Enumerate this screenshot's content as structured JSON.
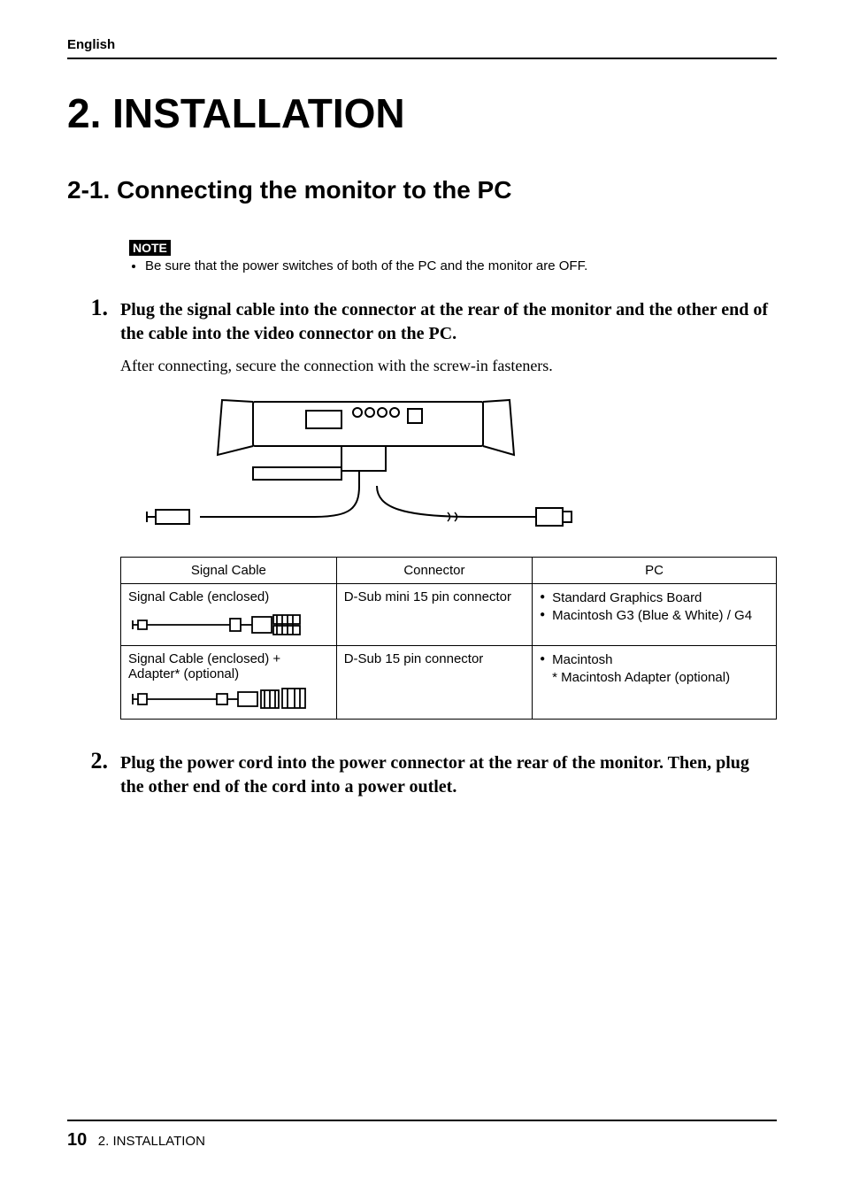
{
  "header": {
    "language": "English"
  },
  "chapter": {
    "title": "2. INSTALLATION"
  },
  "section": {
    "title": "2-1. Connecting the monitor to the PC"
  },
  "note": {
    "badge": "NOTE",
    "items": [
      "Be sure that the power switches of both of the PC and the monitor are OFF."
    ]
  },
  "steps": [
    {
      "number": "1.",
      "heading": "Plug the signal cable into the connector at the rear of the monitor and the other end of the cable into the video connector on the PC.",
      "subtext": "After connecting, secure the connection with the screw-in fasteners."
    },
    {
      "number": "2.",
      "heading": "Plug the power cord into the power connector at the rear of the monitor.  Then, plug the other end of the cord into a power outlet."
    }
  ],
  "table": {
    "headers": [
      "Signal Cable",
      "Connector",
      "PC"
    ],
    "rows": [
      {
        "signal": "Signal Cable (enclosed)",
        "connector": "D-Sub mini 15 pin connector",
        "pc": [
          "Standard Graphics Board",
          "Macintosh G3 (Blue & White) / G4"
        ]
      },
      {
        "signal_line1": "Signal Cable (enclosed) +",
        "signal_line2": "Adapter* (optional)",
        "connector": "D-Sub 15 pin connector",
        "pc": [
          "Macintosh"
        ],
        "pc_note": "* Macintosh Adapter (optional)"
      }
    ]
  },
  "footer": {
    "page_number": "10",
    "section_ref": "2. INSTALLATION"
  }
}
